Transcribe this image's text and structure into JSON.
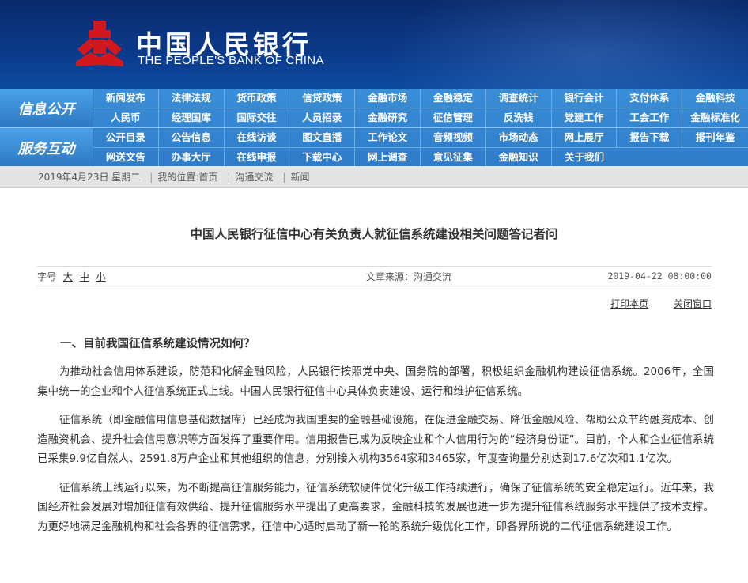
{
  "header": {
    "bank_name_cn": "中国人民银行",
    "bank_name_en": "THE PEOPLE'S BANK OF CHINA",
    "brand_color": "#0b3a8a",
    "logo_color": "#d2181c"
  },
  "nav": {
    "block1_title": "信息公开",
    "block2_title": "服务互动",
    "row1": [
      "新闻发布",
      "法律法规",
      "货币政策",
      "信贷政策",
      "金融市场",
      "金融稳定",
      "调查统计",
      "银行会计",
      "支付体系",
      "金融科技"
    ],
    "row2": [
      "人民币",
      "经理国库",
      "国际交往",
      "人员招录",
      "金融研究",
      "征信管理",
      "反洗钱",
      "党建工作",
      "工会工作",
      "金融标准化"
    ],
    "row3": [
      "公开目录",
      "公告信息",
      "在线访谈",
      "图文直播",
      "工作论文",
      "音频视频",
      "市场动态",
      "网上展厅",
      "报告下载",
      "报刊年鉴"
    ],
    "row4": [
      "网送文告",
      "办事大厅",
      "在线申报",
      "下载中心",
      "网上调查",
      "意见征集",
      "金融知识",
      "关于我们"
    ]
  },
  "breadcrumb": {
    "date": "2019年4月23日 星期二",
    "location_label": "我的位置:首页",
    "level1": "沟通交流",
    "level2": "新闻"
  },
  "article": {
    "title": "中国人民银行征信中心有关负责人就征信系统建设相关问题答记者问",
    "font_size_label": "字号",
    "font_large": "大",
    "font_medium": "中",
    "font_small": "小",
    "source": "文章来源：沟通交流",
    "datetime": "2019-04-22 08:00:00",
    "print_label": "打印本页",
    "close_label": "关闭窗口",
    "section_heading": "一、目前我国征信系统建设情况如何？",
    "paragraphs": [
      "为推动社会信用体系建设，防范和化解金融风险，人民银行按照党中央、国务院的部署，积极组织金融机构建设征信系统。2006年，全国集中统一的企业和个人征信系统正式上线。中国人民银行征信中心具体负责建设、运行和维护征信系统。",
      "征信系统（即金融信用信息基础数据库）已经成为我国重要的金融基础设施，在促进金融交易、降低金融风险、帮助公众节约融资成本、创造融资机会、提升社会信用意识等方面发挥了重要作用。信用报告已成为反映企业和个人信用行为的“经济身份证”。目前，个人和企业征信系统已采集9.9亿自然人、2591.8万户企业和其他组织的信息，分别接入机构3564家和3465家，年度查询量分别达到17.6亿次和1.1亿次。",
      "征信系统上线运行以来，为不断提高征信服务能力，征信系统软硬件优化升级工作持续进行，确保了征信系统的安全稳定运行。近年来，我国经济社会发展对增加征信有效供给、提升征信服务水平提出了更高要求，金融科技的发展也进一步为提升征信系统服务水平提供了技术支撑。为更好地满足金融机构和社会各界的征信需求，征信中心适时启动了新一轮的系统升级优化工作，即各界所说的二代征信系统建设工作。"
    ]
  }
}
